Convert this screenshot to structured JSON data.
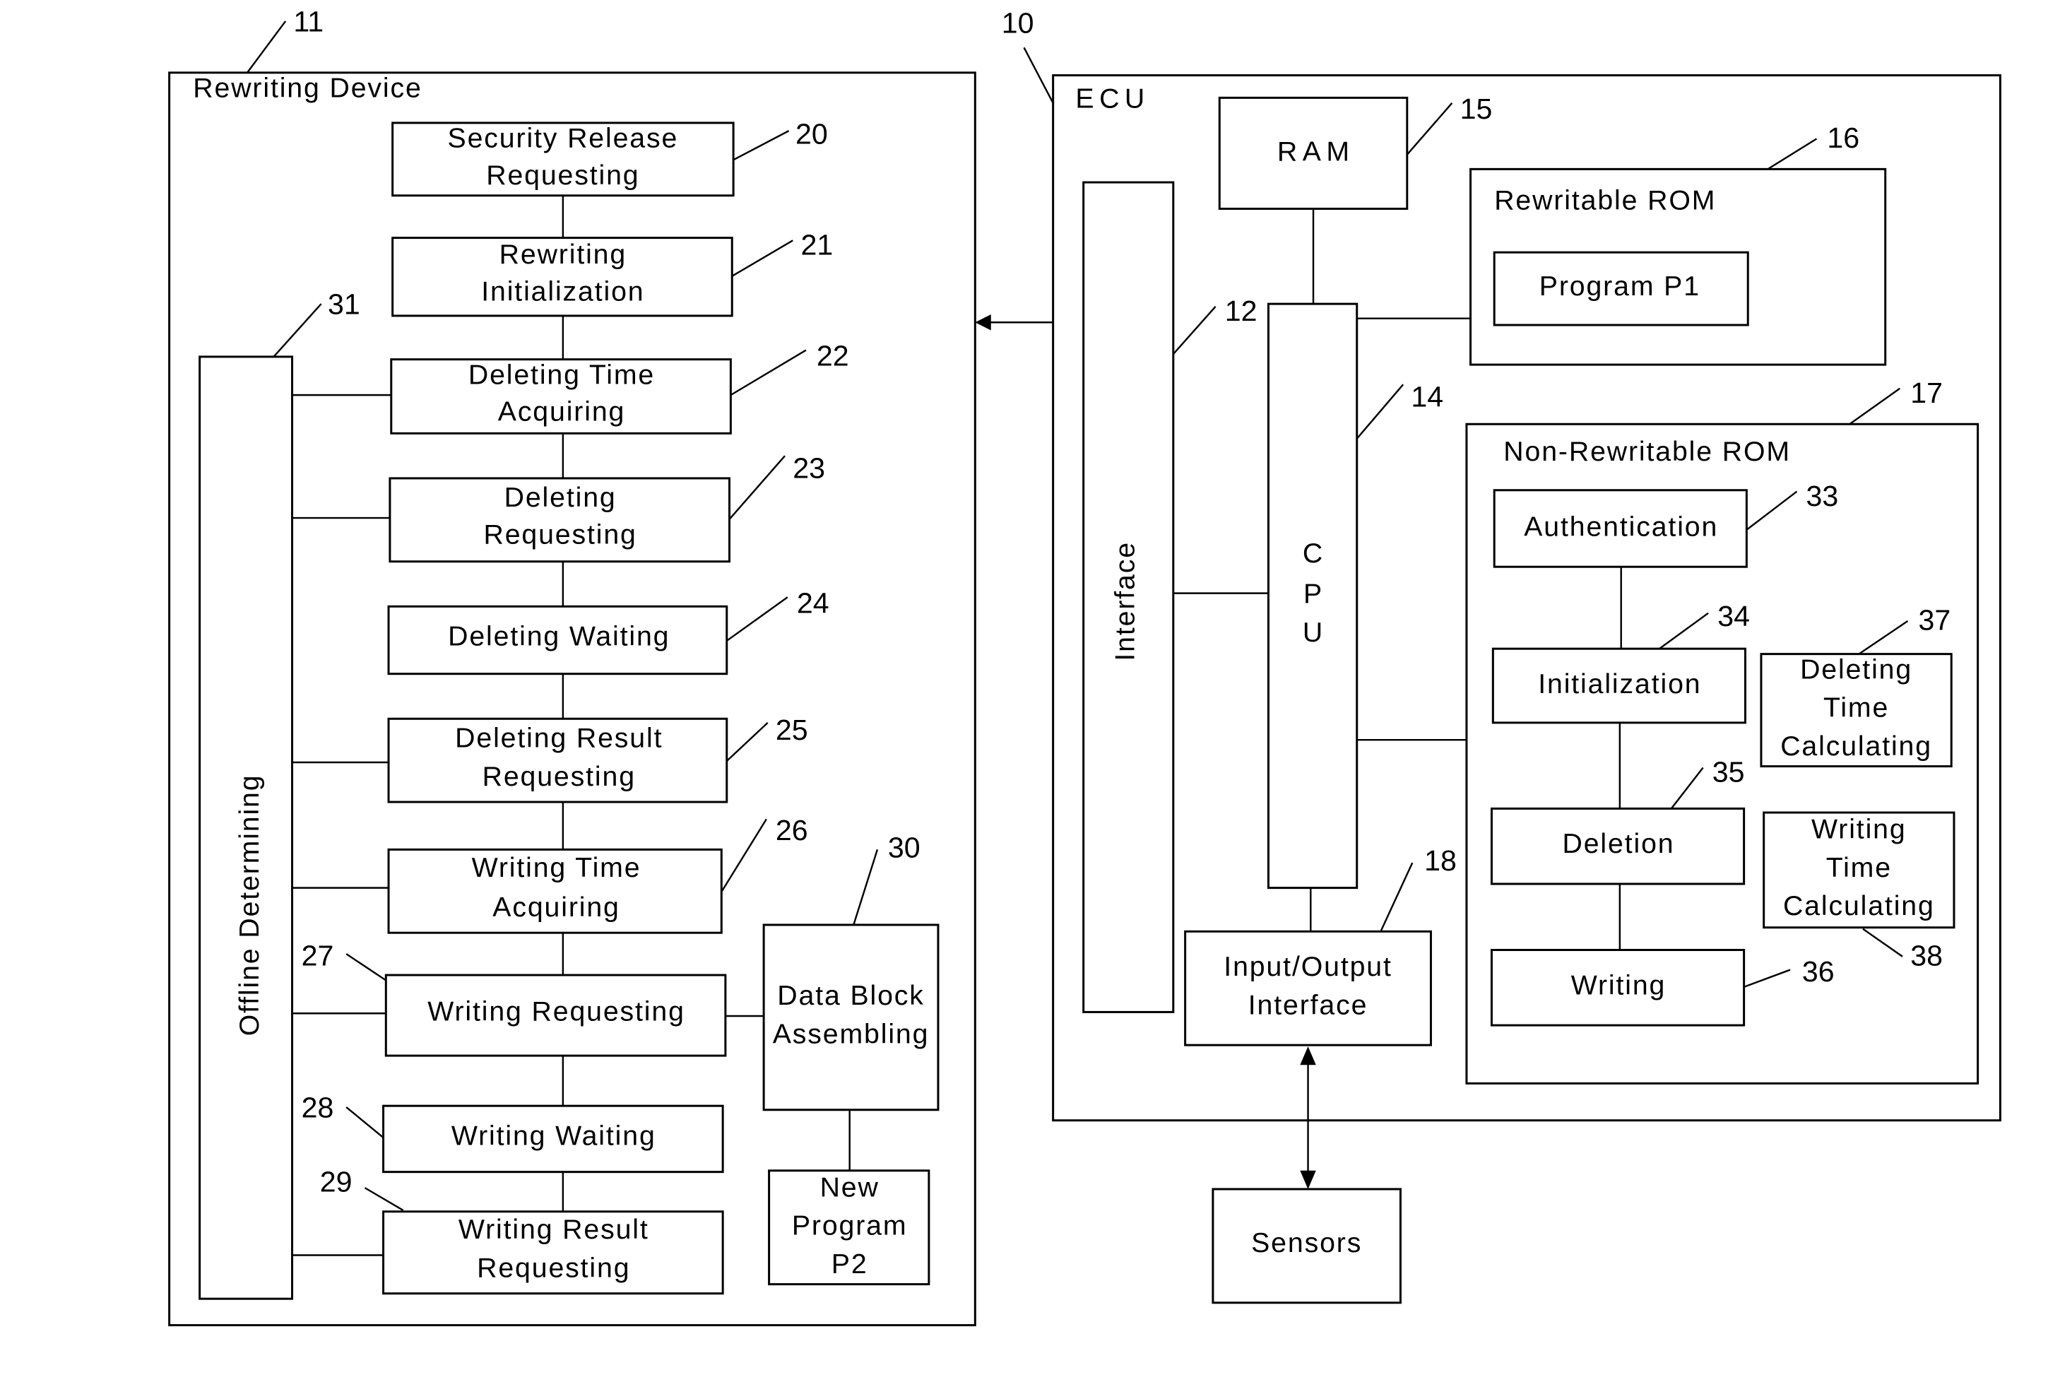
{
  "rewriting_device": {
    "title": "Rewriting Device",
    "ref": "11",
    "blocks": [
      {
        "ref": "20",
        "lines": [
          "Security Release",
          "Requesting"
        ]
      },
      {
        "ref": "21",
        "lines": [
          "Rewriting",
          "Initialization"
        ]
      },
      {
        "ref": "22",
        "lines": [
          "Deleting Time",
          "Acquiring"
        ]
      },
      {
        "ref": "23",
        "lines": [
          "Deleting",
          "Requesting"
        ]
      },
      {
        "ref": "24",
        "lines": [
          "Deleting Waiting"
        ]
      },
      {
        "ref": "25",
        "lines": [
          "Deleting Result",
          "Requesting"
        ]
      },
      {
        "ref": "26",
        "lines": [
          "Writing Time",
          "Acquiring"
        ]
      },
      {
        "ref": "27",
        "lines": [
          "Writing Requesting"
        ]
      },
      {
        "ref": "28",
        "lines": [
          "Writing Waiting"
        ]
      },
      {
        "ref": "29",
        "lines": [
          "Writing Result",
          "Requesting"
        ]
      }
    ],
    "offline": {
      "ref": "31",
      "label": "Offline Determining"
    },
    "data_block": {
      "ref": "30",
      "lines": [
        "Data Block",
        "Assembling"
      ]
    },
    "new_program": {
      "lines": [
        "New",
        "Program",
        "P2"
      ]
    }
  },
  "ecu": {
    "title": "ECU",
    "ref": "10",
    "interface": {
      "ref": "12",
      "label": "Interface"
    },
    "cpu": {
      "ref": "14",
      "label": "CPU"
    },
    "ram": {
      "ref": "15",
      "label": "RAM"
    },
    "rewritable_rom": {
      "ref": "16",
      "label": "Rewritable ROM",
      "program": "Program P1"
    },
    "non_rewritable_rom": {
      "ref": "17",
      "label": "Non-Rewritable ROM",
      "authentication": {
        "ref": "33",
        "label": "Authentication"
      },
      "initialization": {
        "ref": "34",
        "label": "Initialization"
      },
      "deletion": {
        "ref": "35",
        "label": "Deletion"
      },
      "writing": {
        "ref": "36",
        "label": "Writing"
      },
      "deleting_time_calc": {
        "ref": "37",
        "lines": [
          "Deleting",
          "Time",
          "Calculating"
        ]
      },
      "writing_time_calc": {
        "ref": "38",
        "lines": [
          "Writing",
          "Time",
          "Calculating"
        ]
      }
    },
    "io_interface": {
      "ref": "18",
      "lines": [
        "Input/Output",
        "Interface"
      ]
    }
  },
  "sensors": {
    "label": "Sensors"
  }
}
